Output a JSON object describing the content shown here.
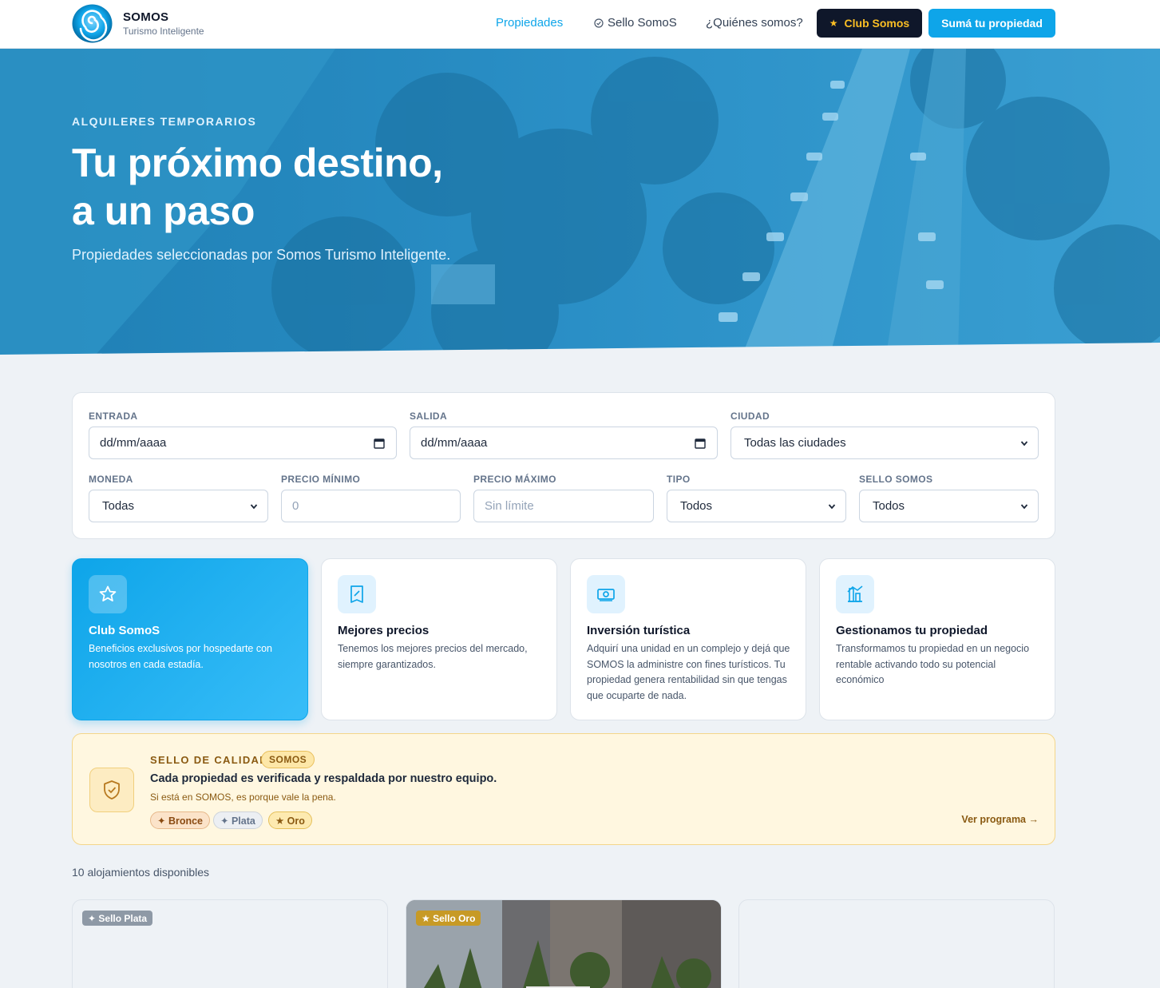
{
  "header": {
    "brand_name": "SOMOS",
    "brand_sub": "Turismo Inteligente",
    "nav": {
      "propiedades": "Propiedades",
      "sello": "Sello SomoS",
      "quienes": "¿Quiénes somos?"
    },
    "club_button": "Club Somos",
    "suma_button": "Sumá tu propiedad"
  },
  "hero": {
    "kicker": "ALQUILERES TEMPORARIOS",
    "title_line1": "Tu próximo destino,",
    "title_line2": "a un paso",
    "subtitle": "Propiedades seleccionadas por Somos Turismo Inteligente."
  },
  "filters": {
    "entrada": {
      "label": "ENTRADA",
      "value": "dd/mm/aaaa"
    },
    "salida": {
      "label": "SALIDA",
      "value": "dd/mm/aaaa"
    },
    "ciudad": {
      "label": "CIUDAD",
      "value": "Todas las ciudades"
    },
    "moneda": {
      "label": "MONEDA",
      "value": "Todas"
    },
    "precio_min": {
      "label": "PRECIO MÍNIMO",
      "placeholder": "0"
    },
    "precio_max": {
      "label": "PRECIO MÁXIMO",
      "placeholder": "Sin límite"
    },
    "tipo": {
      "label": "TIPO",
      "value": "Todos"
    },
    "sello": {
      "label": "SELLO SOMOS",
      "value": "Todos"
    }
  },
  "features": [
    {
      "title": "Club SomoS",
      "text": "Beneficios exclusivos por hospedarte con nosotros en cada estadía.",
      "icon": "star-icon"
    },
    {
      "title": "Mejores precios",
      "text": "Tenemos los mejores precios del mercado, siempre garantizados.",
      "icon": "receipt-icon"
    },
    {
      "title": "Inversión turística",
      "text": "Adquirí una unidad en un complejo y dejá que SOMOS la administre con fines turísticos. Tu propiedad genera rentabilidad sin que tengas que ocuparte de nada.",
      "icon": "money-icon"
    },
    {
      "title": "Gestionamos tu propiedad",
      "text": "Transformamos tu propiedad en un negocio rentable activando todo su potencial económico",
      "icon": "building-chart-icon"
    }
  ],
  "sello_banner": {
    "kicker": "SELLO DE CALIDAD",
    "tag": "SOMOS",
    "title": "Cada propiedad es verificada y respaldada por nuestro equipo.",
    "subtitle": "Si está en SOMOS, es porque vale la pena.",
    "chips": [
      "✦ Bronce",
      "✦ Plata",
      "★ Oro"
    ],
    "link": "Ver programa →"
  },
  "results_count": "10 alojamientos disponibles",
  "listings": [
    {
      "badge": "✦ Sello Plata"
    },
    {
      "badge": "★ Sello Oro"
    },
    {
      "badge": ""
    }
  ],
  "colors": {
    "accent": "#0ea5e9",
    "dark": "#0f172a",
    "gold": "#fbbf24",
    "sello_bg": "#fff7e0"
  }
}
